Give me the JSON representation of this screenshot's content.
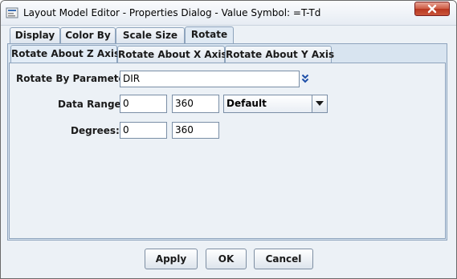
{
  "window": {
    "title": "Layout Model Editor - Properties Dialog - Value Symbol: =T-Td"
  },
  "outer_tabs": [
    {
      "label": "Display",
      "selected": false
    },
    {
      "label": "Color By",
      "selected": false
    },
    {
      "label": "Scale Size",
      "selected": false
    },
    {
      "label": "Rotate",
      "selected": true
    }
  ],
  "inner_tabs": [
    {
      "label": "Rotate About Z Axis",
      "selected": true
    },
    {
      "label": "Rotate About X Axis",
      "selected": false
    },
    {
      "label": "Rotate About Y Axis",
      "selected": false
    }
  ],
  "form": {
    "rotate_by_parameter_label": "Rotate By Parameter:",
    "rotate_by_parameter_value": "DIR",
    "data_range_label": "Data Range:",
    "data_range_min": "0",
    "data_range_max": "360",
    "data_range_mode": "Default",
    "degrees_label": "Degrees:",
    "degrees_min": "0",
    "degrees_max": "360"
  },
  "buttons": {
    "apply": "Apply",
    "ok": "OK",
    "cancel": "Cancel"
  },
  "colors": {
    "panel_background": "#ecf1f6",
    "tab_border": "#8ea4bd",
    "close_button": "#c9563b",
    "chevron_accent": "#1e4fa8"
  }
}
